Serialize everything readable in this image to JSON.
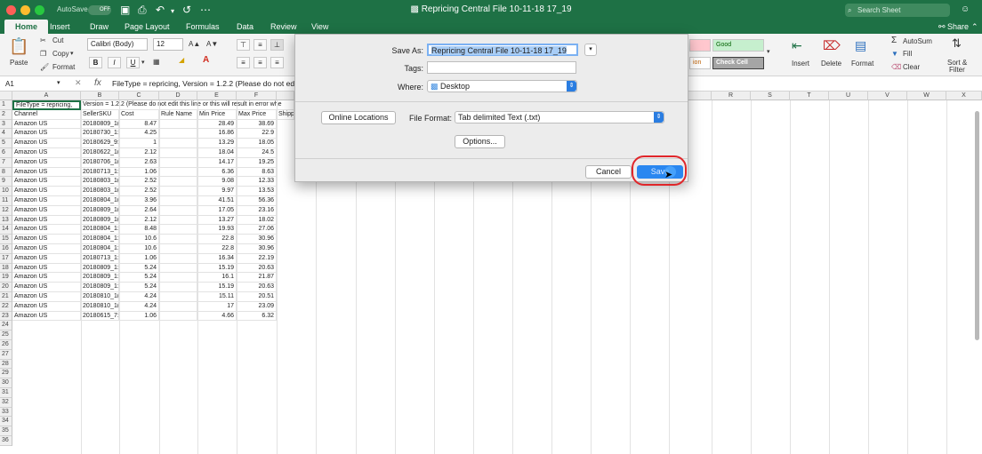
{
  "window": {
    "title": "Repricing Central File 10-11-18 17_19",
    "autosave_label": "AutoSave",
    "autosave_state": "OFF",
    "search_placeholder": "Search Sheet",
    "share_label": "Share",
    "accent_color": "#1e7145"
  },
  "tabs": [
    "Home",
    "Insert",
    "Draw",
    "Page Layout",
    "Formulas",
    "Data",
    "Review",
    "View"
  ],
  "ribbon": {
    "paste": "Paste",
    "cut": "Cut",
    "copy": "Copy",
    "format_painter": "Format",
    "font_name": "Calibri (Body)",
    "font_size": "12",
    "style_good": "Good",
    "style_check_cell": "Check Cell",
    "style_partial": "ion",
    "insert": "Insert",
    "delete": "Delete",
    "format": "Format",
    "autosum": "AutoSum",
    "fill": "Fill",
    "clear": "Clear",
    "sort_filter_1": "Sort &",
    "sort_filter_2": "Filter"
  },
  "formula_bar": {
    "name_box": "A1",
    "fx": "fx",
    "formula": "FileType = repricing,  Version = 1.2.2 (Please do not ed"
  },
  "grid": {
    "left_columns": [
      "A",
      "B",
      "C",
      "D",
      "E",
      "F"
    ],
    "right_columns": [
      "R",
      "S",
      "T",
      "U",
      "V",
      "W",
      "X"
    ],
    "row1": {
      "a": "FileType = repricing,",
      "rest": "Version = 1.2.2 (Please do not edit this line or this will result in error whe"
    },
    "headers": [
      "Channel",
      "SellerSKU",
      "Cost",
      "Rule Name",
      "Min Price",
      "Max Price",
      "Shippi"
    ],
    "rows": [
      [
        "Amazon US",
        "20180809_1(",
        "8.47",
        "",
        "28.49",
        "38.69"
      ],
      [
        "Amazon US",
        "20180730_1:",
        "4.25",
        "",
        "16.86",
        "22.9"
      ],
      [
        "Amazon US",
        "20180629_9:",
        "1",
        "",
        "13.29",
        "18.05"
      ],
      [
        "Amazon US",
        "20180622_1(",
        "2.12",
        "",
        "18.04",
        "24.5"
      ],
      [
        "Amazon US",
        "20180706_1(",
        "2.63",
        "",
        "14.17",
        "19.25"
      ],
      [
        "Amazon US",
        "20180713_1:",
        "1.06",
        "",
        "6.36",
        "8.63"
      ],
      [
        "Amazon US",
        "20180803_1(",
        "2.52",
        "",
        "9.08",
        "12.33"
      ],
      [
        "Amazon US",
        "20180803_1(",
        "2.52",
        "",
        "9.97",
        "13.53"
      ],
      [
        "Amazon US",
        "20180804_1(",
        "3.96",
        "",
        "41.51",
        "56.36"
      ],
      [
        "Amazon US",
        "20180809_1(",
        "2.64",
        "",
        "17.05",
        "23.16"
      ],
      [
        "Amazon US",
        "20180809_1(",
        "2.12",
        "",
        "13.27",
        "18.02"
      ],
      [
        "Amazon US",
        "20180804_1:",
        "8.48",
        "",
        "19.93",
        "27.06"
      ],
      [
        "Amazon US",
        "20180804_1:",
        "10.6",
        "",
        "22.8",
        "30.96"
      ],
      [
        "Amazon US",
        "20180804_1:",
        "10.6",
        "",
        "22.8",
        "30.96"
      ],
      [
        "Amazon US",
        "20180713_1:",
        "1.06",
        "",
        "16.34",
        "22.19"
      ],
      [
        "Amazon US",
        "20180809_1:",
        "5.24",
        "",
        "15.19",
        "20.63"
      ],
      [
        "Amazon US",
        "20180809_1:",
        "5.24",
        "",
        "16.1",
        "21.87"
      ],
      [
        "Amazon US",
        "20180809_1:",
        "5.24",
        "",
        "15.19",
        "20.63"
      ],
      [
        "Amazon US",
        "20180810_1(",
        "4.24",
        "",
        "15.11",
        "20.51"
      ],
      [
        "Amazon US",
        "20180810_1(",
        "4.24",
        "",
        "17",
        "23.09"
      ],
      [
        "Amazon US",
        "20180615_7:",
        "1.06",
        "",
        "4.66",
        "6.32"
      ]
    ],
    "row_numbers": [
      "1",
      "2",
      "3",
      "4",
      "5",
      "6",
      "7",
      "8",
      "9",
      "10",
      "11",
      "12",
      "13",
      "14",
      "15",
      "16",
      "17",
      "18",
      "19",
      "20",
      "21",
      "22",
      "23",
      "24",
      "25",
      "26",
      "27",
      "28",
      "29",
      "30",
      "31",
      "32",
      "33",
      "34",
      "35",
      "36"
    ]
  },
  "dialog": {
    "save_as_label": "Save As:",
    "save_as_value": "Repricing Central File 10-11-18 17_19",
    "tags_label": "Tags:",
    "tags_value": "",
    "where_label": "Where:",
    "where_value": "Desktop",
    "online_locations": "Online Locations",
    "file_format_label": "File Format:",
    "file_format_value": "Tab delimited Text (.txt)",
    "options": "Options...",
    "cancel": "Cancel",
    "save": "Save",
    "highlight_color": "#e0262a"
  }
}
